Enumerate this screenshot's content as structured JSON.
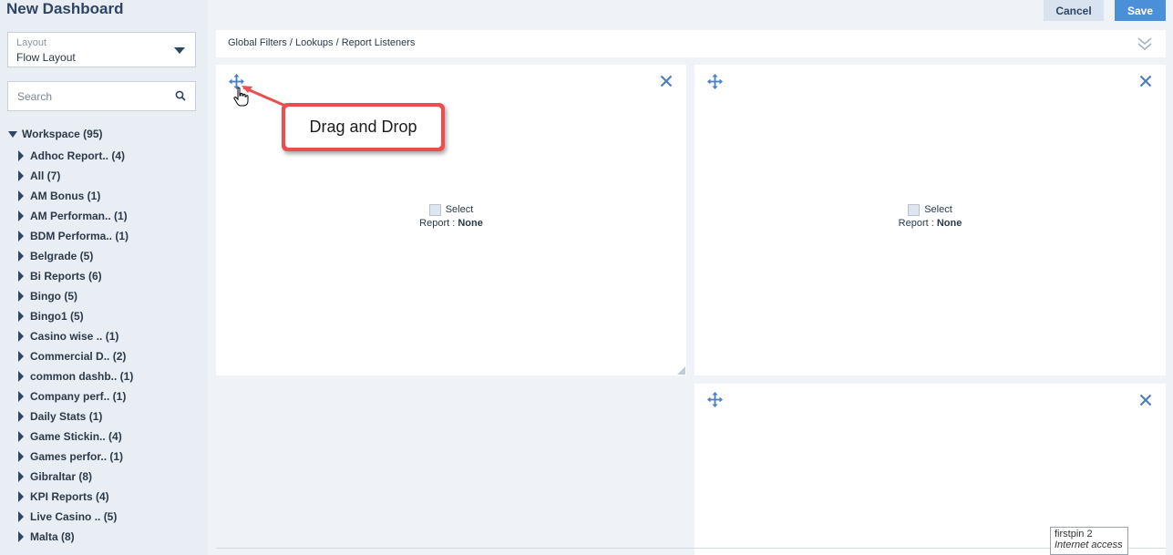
{
  "page": {
    "title": "New Dashboard"
  },
  "layout_select": {
    "label": "Layout",
    "value": "Flow Layout"
  },
  "search": {
    "placeholder": "Search"
  },
  "tree": {
    "root": "Workspace (95)",
    "items": [
      "Adhoc Report.. (4)",
      "All (7)",
      "AM Bonus (1)",
      "AM Performan.. (1)",
      "BDM Performa.. (1)",
      "Belgrade (5)",
      "Bi Reports (6)",
      "Bingo (5)",
      "Bingo1 (5)",
      "Casino wise .. (1)",
      "Commercial D.. (2)",
      "common dashb.. (1)",
      "Company perf.. (1)",
      "Daily Stats (1)",
      "Game Stickin.. (4)",
      "Games perfor.. (1)",
      "Gibraltar (8)",
      "KPI Reports (4)",
      "Live Casino .. (5)",
      "Malta (8)"
    ]
  },
  "toolbar": {
    "cancel_label": "Cancel",
    "save_label": "Save"
  },
  "filter_bar": {
    "text": "Global Filters / Lookups / Report Listeners"
  },
  "panels": {
    "p1": {
      "select_label": "Select",
      "report_label": "Report :",
      "report_value": "None"
    },
    "p2": {
      "select_label": "Select",
      "report_label": "Report :",
      "report_value": "None"
    }
  },
  "annotation": {
    "text": "Drag and Drop"
  },
  "tooltip": {
    "line1": "firstpin  2",
    "line2": "Internet access"
  },
  "colors": {
    "accent": "#4a90d9",
    "annotation": "#ea4f4f",
    "sidebar_bg": "#e9edf4",
    "icon_blue": "#4a7fc1"
  },
  "icons": [
    "move-icon",
    "close-icon",
    "search-icon",
    "double-chevron-down-icon",
    "pointer-cursor-icon"
  ]
}
